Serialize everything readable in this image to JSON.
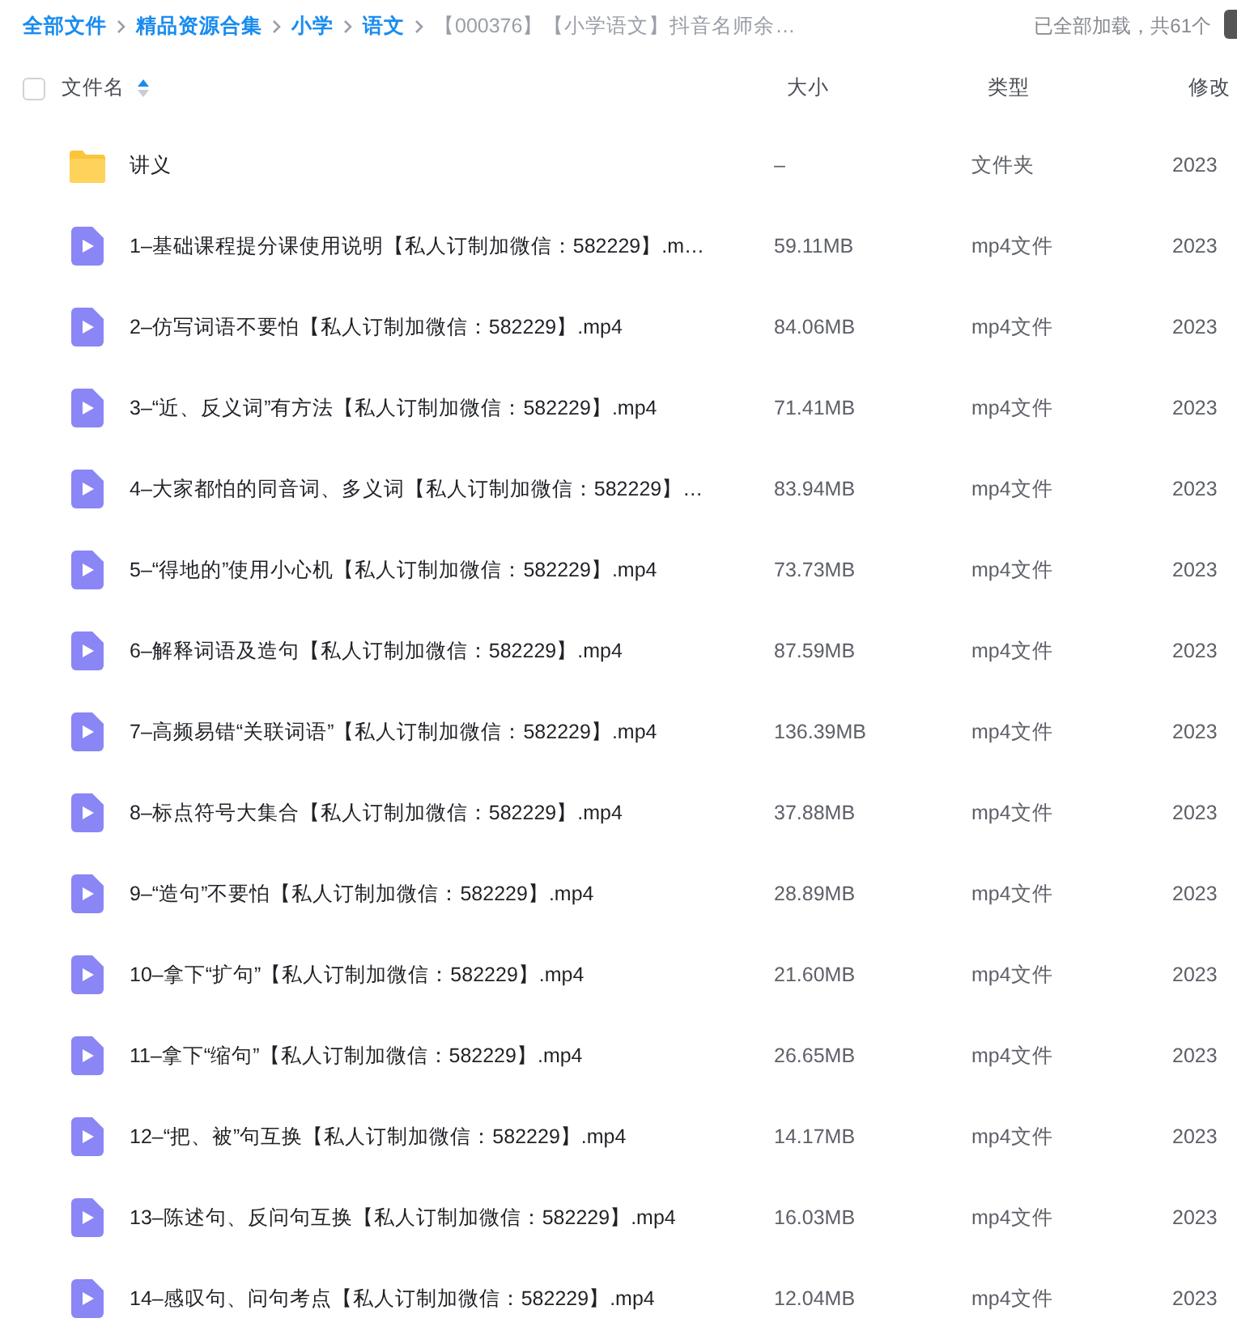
{
  "breadcrumb": [
    {
      "label": "全部文件",
      "kind": "link"
    },
    {
      "label": "精品资源合集",
      "kind": "link"
    },
    {
      "label": "小学",
      "kind": "link"
    },
    {
      "label": "语文",
      "kind": "link"
    },
    {
      "label": "【000376】【小学语文】抖音名师余…",
      "kind": "current"
    }
  ],
  "load_status": "已全部加载，共61个",
  "header": {
    "checked": false,
    "columns": [
      "文件名",
      "大小",
      "类型",
      "修改"
    ]
  },
  "files": [
    {
      "kind": "folder",
      "name": "讲义",
      "size": "–",
      "type": "文件夹",
      "modified": "2023"
    },
    {
      "kind": "video",
      "name": "1–基础课程提分课使用说明【私人订制加微信：582229】.m…",
      "size": "59.11MB",
      "type": "mp4文件",
      "modified": "2023"
    },
    {
      "kind": "video",
      "name": "2–仿写词语不要怕【私人订制加微信：582229】.mp4",
      "size": "84.06MB",
      "type": "mp4文件",
      "modified": "2023"
    },
    {
      "kind": "video",
      "name": "3–“近、反义词”有方法【私人订制加微信：582229】.mp4",
      "size": "71.41MB",
      "type": "mp4文件",
      "modified": "2023"
    },
    {
      "kind": "video",
      "name": "4–大家都怕的同音词、多义词【私人订制加微信：582229】…",
      "size": "83.94MB",
      "type": "mp4文件",
      "modified": "2023"
    },
    {
      "kind": "video",
      "name": "5–“得地的”使用小心机【私人订制加微信：582229】.mp4",
      "size": "73.73MB",
      "type": "mp4文件",
      "modified": "2023"
    },
    {
      "kind": "video",
      "name": "6–解释词语及造句【私人订制加微信：582229】.mp4",
      "size": "87.59MB",
      "type": "mp4文件",
      "modified": "2023"
    },
    {
      "kind": "video",
      "name": "7–高频易错“关联词语”【私人订制加微信：582229】.mp4",
      "size": "136.39MB",
      "type": "mp4文件",
      "modified": "2023"
    },
    {
      "kind": "video",
      "name": "8–标点符号大集合【私人订制加微信：582229】.mp4",
      "size": "37.88MB",
      "type": "mp4文件",
      "modified": "2023"
    },
    {
      "kind": "video",
      "name": "9–“造句”不要怕【私人订制加微信：582229】.mp4",
      "size": "28.89MB",
      "type": "mp4文件",
      "modified": "2023"
    },
    {
      "kind": "video",
      "name": "10–拿下“扩句”【私人订制加微信：582229】.mp4",
      "size": "21.60MB",
      "type": "mp4文件",
      "modified": "2023"
    },
    {
      "kind": "video",
      "name": "11–拿下“缩句”【私人订制加微信：582229】.mp4",
      "size": "26.65MB",
      "type": "mp4文件",
      "modified": "2023"
    },
    {
      "kind": "video",
      "name": "12–“把、被”句互换【私人订制加微信：582229】.mp4",
      "size": "14.17MB",
      "type": "mp4文件",
      "modified": "2023"
    },
    {
      "kind": "video",
      "name": "13–陈述句、反问句互换【私人订制加微信：582229】.mp4",
      "size": "16.03MB",
      "type": "mp4文件",
      "modified": "2023"
    },
    {
      "kind": "video",
      "name": "14–感叹句、问句考点【私人订制加微信：582229】.mp4",
      "size": "12.04MB",
      "type": "mp4文件",
      "modified": "2023"
    }
  ]
}
